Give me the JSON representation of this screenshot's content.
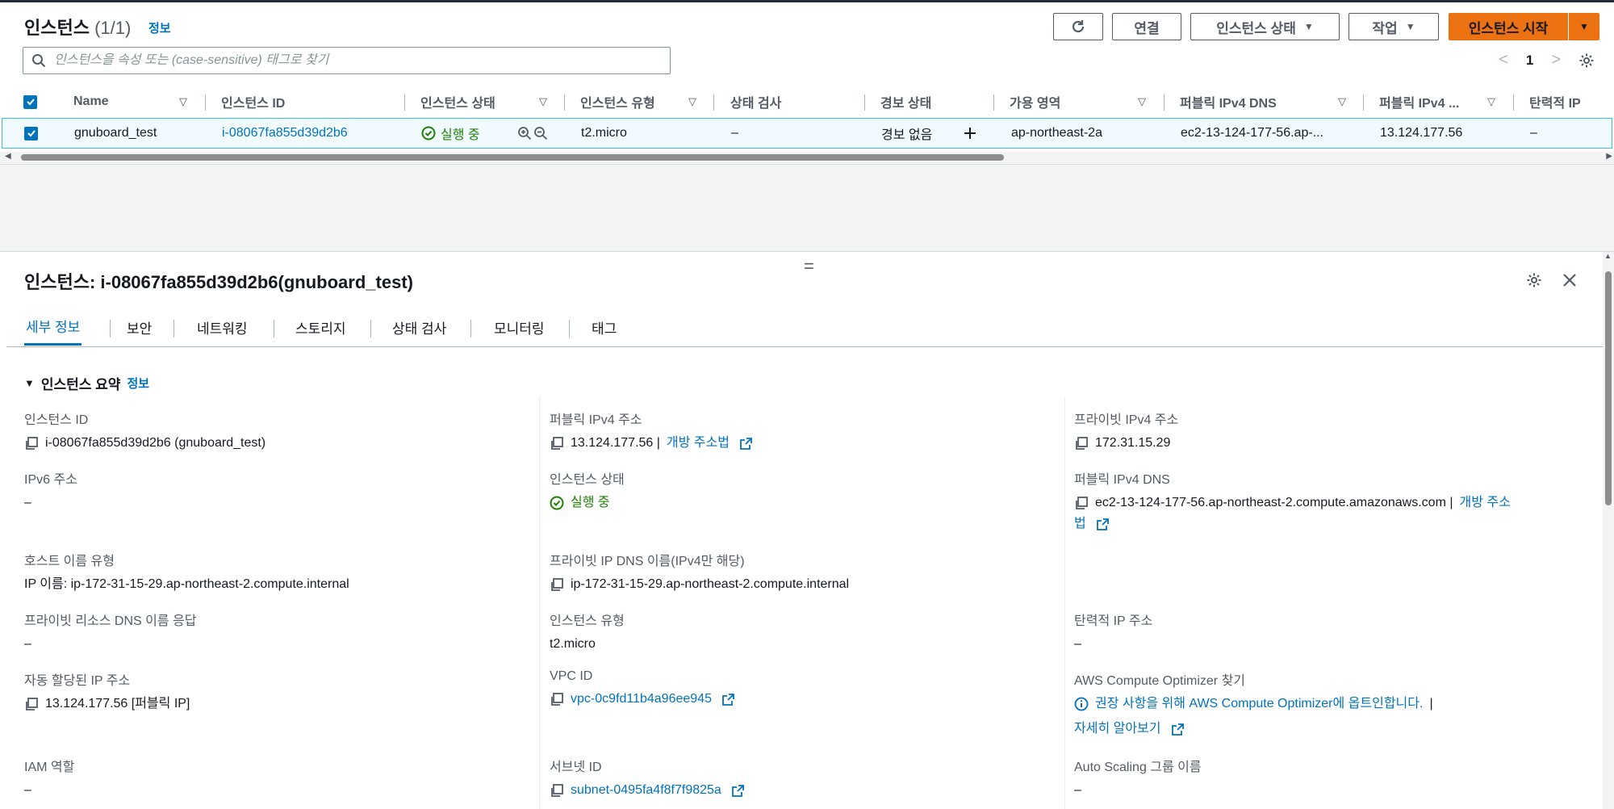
{
  "list": {
    "title": "인스턴스",
    "count": "(1/1)",
    "info": "정보",
    "buttons": {
      "connect": "연결",
      "instance_state": "인스턴스 상태",
      "actions": "작업",
      "launch": "인스턴스 시작"
    },
    "search_placeholder": "인스턴스을 속성 또는 (case-sensitive) 태그로 찾기",
    "page": "1"
  },
  "table": {
    "headers": [
      "Name",
      "인스턴스 ID",
      "인스턴스 상태",
      "인스턴스 유형",
      "상태 검사",
      "경보 상태",
      "가용 영역",
      "퍼블릭 IPv4 DNS",
      "퍼블릭 IPv4 ...",
      "탄력적 IP"
    ],
    "row": {
      "name": "gnuboard_test",
      "instance_id": "i-08067fa855d39d2b6",
      "state": "실행 중",
      "type": "t2.micro",
      "status_check": "–",
      "alarm": "경보 없음",
      "az": "ap-northeast-2a",
      "public_dns": "ec2-13-124-177-56.ap-...",
      "public_ip": "13.124.177.56",
      "elastic_ip": "–"
    }
  },
  "detail": {
    "title": "인스턴스: i-08067fa855d39d2b6(gnuboard_test)",
    "tabs": [
      "세부 정보",
      "보안",
      "네트워킹",
      "스토리지",
      "상태 검사",
      "모니터링",
      "태그"
    ],
    "section": "인스턴스 요약",
    "section_info": "정보",
    "col1": {
      "instance_id_label": "인스턴스 ID",
      "instance_id": "i-08067fa855d39d2b6 (gnuboard_test)",
      "ipv6_label": "IPv6 주소",
      "ipv6": "–",
      "hostname_type_label": "호스트 이름 유형",
      "hostname_type": "IP 이름: ip-172-31-15-29.ap-northeast-2.compute.internal",
      "private_dns_answer_label": "프라이빗 리소스 DNS 이름 응답",
      "private_dns_answer": "–",
      "auto_ip_label": "자동 할당된 IP 주소",
      "auto_ip": "13.124.177.56 [퍼블릭 IP]",
      "iam_label": "IAM 역할",
      "iam": "–"
    },
    "col2": {
      "public_ipv4_label": "퍼블릭 IPv4 주소",
      "public_ipv4": "13.124.177.56 |",
      "open_address": "개방 주소법",
      "state_label": "인스턴스 상태",
      "state": "실행 중",
      "private_ip_dns_label": "프라이빗 IP DNS 이름(IPv4만 해당)",
      "private_ip_dns": "ip-172-31-15-29.ap-northeast-2.compute.internal",
      "type_label": "인스턴스 유형",
      "type": "t2.micro",
      "vpc_label": "VPC ID",
      "vpc": "vpc-0c9fd11b4a96ee945",
      "subnet_label": "서브넷 ID",
      "subnet": "subnet-0495fa4f8f7f9825a"
    },
    "col3": {
      "private_ipv4_label": "프라이빗 IPv4 주소",
      "private_ipv4": "172.31.15.29",
      "public_dns_label": "퍼블릭 IPv4 DNS",
      "public_dns": "ec2-13-124-177-56.ap-northeast-2.compute.amazonaws.com |",
      "open_address_1": "개방 주소",
      "open_address_2": "법",
      "elastic_ip_label": "탄력적 IP 주소",
      "elastic_ip": "–",
      "optimizer_label": "AWS Compute Optimizer 찾기",
      "optimizer_text": "권장 사항을 위해 AWS Compute Optimizer에 옵트인합니다.",
      "optimizer_sep": "|",
      "learn_more": "자세히 알아보기",
      "asg_label": "Auto Scaling 그룹 이름",
      "asg": "–"
    }
  },
  "colors": {
    "link": "#0073bb",
    "success": "#1d8102",
    "primary": "#ec7211"
  }
}
